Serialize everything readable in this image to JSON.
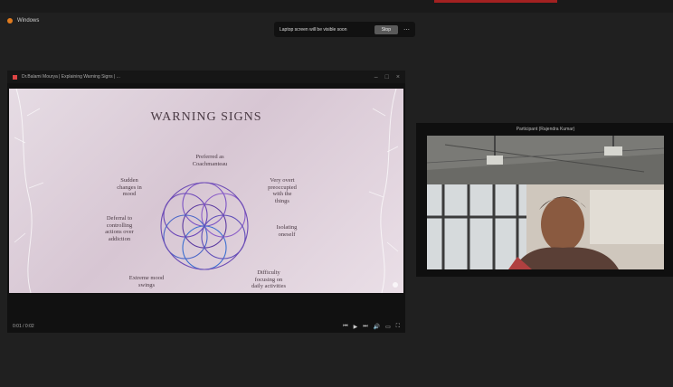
{
  "app": {
    "title": "Windows"
  },
  "share_bar": {
    "message": "Laptop screen will be visible soon",
    "stop_label": "Stop",
    "more_icon": "more-icon"
  },
  "share_window": {
    "title": "Dr.Balami Mourya | Explaining Warning Signs | ...",
    "slide": {
      "title": "WARNING SIGNS",
      "signs": [
        "Preferred as\nCoachmanteau",
        "Sudden\nchanges in\nmood",
        "Very overt\npreoccupied\nwith the\nthings",
        "Deferral to\ncontrolling\nactions over\naddiction",
        "Isolating\noneself",
        "Extreme mood\nswings",
        "Difficulty\nfocusing on\ndaily activities"
      ]
    },
    "player": {
      "time": "0:01 / 0:02"
    }
  },
  "video": {
    "participant_name": "Participant (Rajendra Kumar)"
  },
  "colors": {
    "background": "#202020",
    "slide_bg": "#e0d4de",
    "flower_stroke": "#5a3a9a",
    "accent_red": "#a32121"
  }
}
